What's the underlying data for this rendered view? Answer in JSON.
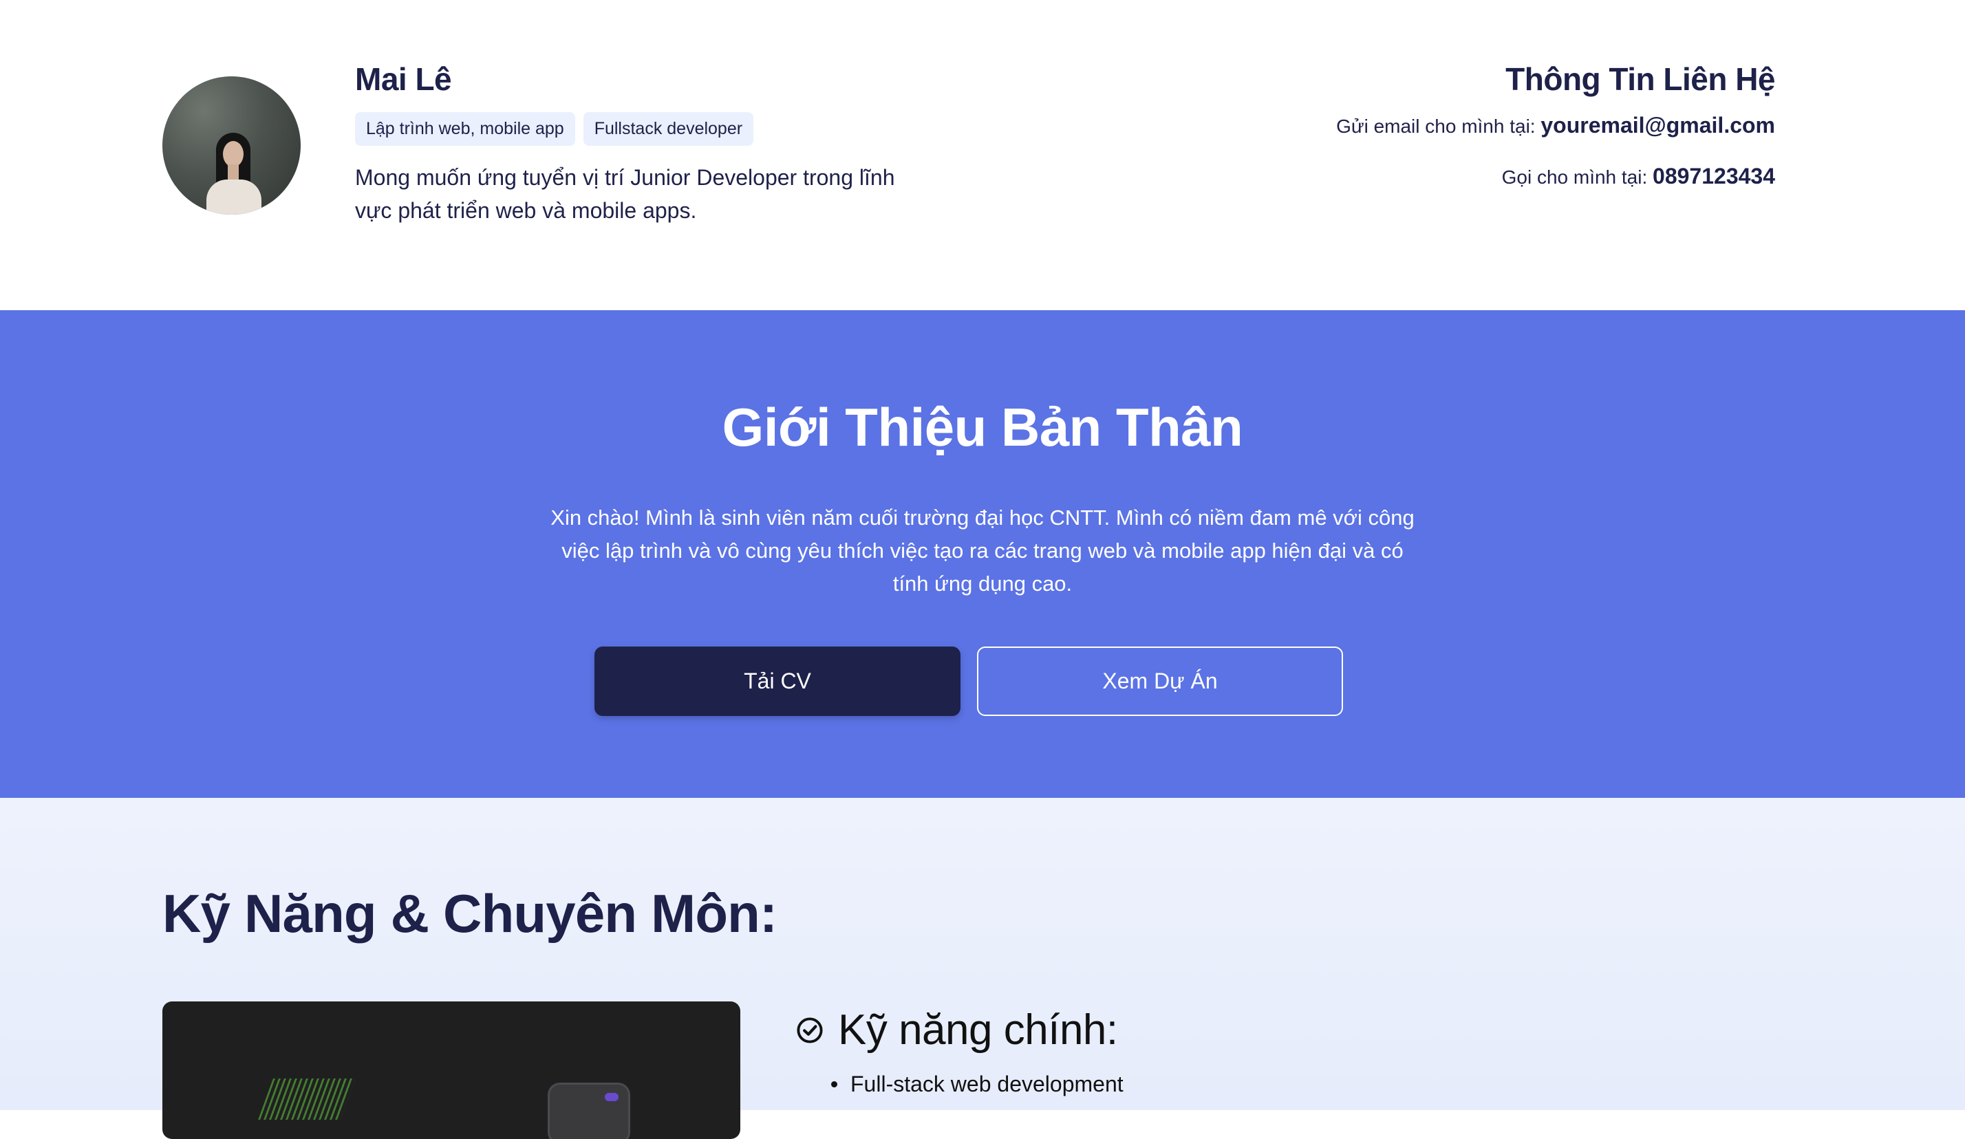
{
  "profile": {
    "name": "Mai Lê",
    "tags": [
      "Lập trình web, mobile app",
      "Fullstack developer"
    ],
    "objective": "Mong muốn ứng tuyển vị trí Junior Developer trong lĩnh vực phát triển web và mobile apps."
  },
  "contact": {
    "title": "Thông Tin Liên Hệ",
    "email_label": "Gửi email cho mình tại: ",
    "email": "youremail@gmail.com",
    "phone_label": "Gọi cho mình tại: ",
    "phone": "0897123434"
  },
  "intro": {
    "title": "Giới Thiệu Bản Thân",
    "text": "Xin chào! Mình là sinh viên năm cuối trường đại học CNTT. Mình có niềm đam mê với công việc lập trình và vô cùng yêu thích việc tạo ra các trang web và mobile app hiện đại và có tính ứng dụng cao.",
    "download_cv_label": "Tải CV",
    "view_projects_label": "Xem Dự Án"
  },
  "skills": {
    "title": "Kỹ Năng & Chuyên Môn:",
    "main_title": "Kỹ năng chính:",
    "items": [
      "Full-stack web development"
    ]
  },
  "colors": {
    "primary": "#5b73e5",
    "dark": "#1e2149",
    "tag_bg": "#eaf0fd"
  },
  "icons": {
    "check": "check-circle-icon"
  }
}
